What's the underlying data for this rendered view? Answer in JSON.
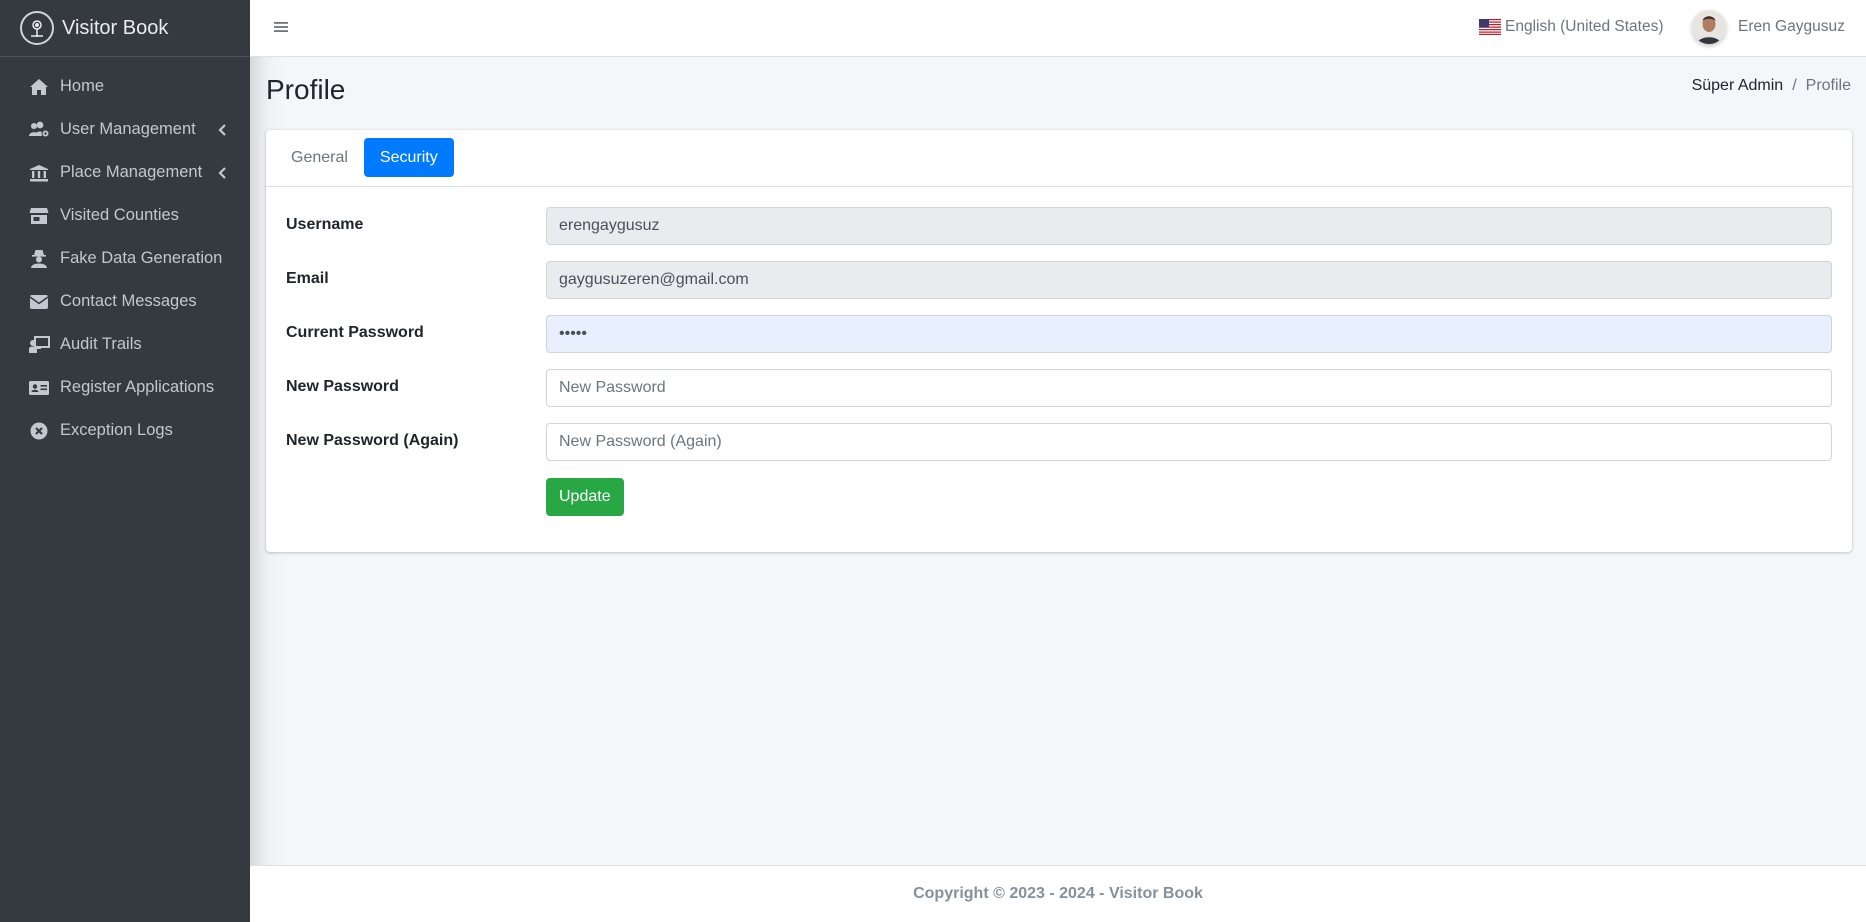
{
  "brand": {
    "name": "Visitor Book",
    "icon": "compass-logo-icon"
  },
  "sidebar": {
    "items": [
      {
        "label": "Home",
        "icon": "home-icon",
        "has_submenu": false
      },
      {
        "label": "User Management",
        "icon": "users-cog-icon",
        "has_submenu": true
      },
      {
        "label": "Place Management",
        "icon": "landmark-icon",
        "has_submenu": true
      },
      {
        "label": "Visited Counties",
        "icon": "store-icon",
        "has_submenu": false
      },
      {
        "label": "Fake Data Generation",
        "icon": "user-secret-icon",
        "has_submenu": false
      },
      {
        "label": "Contact Messages",
        "icon": "envelope-icon",
        "has_submenu": false
      },
      {
        "label": "Audit Trails",
        "icon": "chalkboard-teacher-icon",
        "has_submenu": false
      },
      {
        "label": "Register Applications",
        "icon": "id-card-icon",
        "has_submenu": false
      },
      {
        "label": "Exception Logs",
        "icon": "times-circle-icon",
        "has_submenu": false
      }
    ]
  },
  "topbar": {
    "language": "English (United States)",
    "user_name": "Eren Gaygusuz"
  },
  "page": {
    "title": "Profile",
    "breadcrumb": {
      "parent": "Süper Admin",
      "separator": "/",
      "current": "Profile"
    }
  },
  "tabs": [
    {
      "label": "General",
      "active": false
    },
    {
      "label": "Security",
      "active": true
    }
  ],
  "form": {
    "username": {
      "label": "Username",
      "value": "erengaygusuz",
      "placeholder": ""
    },
    "email": {
      "label": "Email",
      "value": "gaygusuzeren@gmail.com",
      "placeholder": ""
    },
    "current_password": {
      "label": "Current Password",
      "value": "•••••",
      "placeholder": ""
    },
    "new_password": {
      "label": "New Password",
      "value": "",
      "placeholder": "New Password"
    },
    "new_password_again": {
      "label": "New Password (Again)",
      "value": "",
      "placeholder": "New Password (Again)"
    },
    "update_label": "Update"
  },
  "footer": {
    "text": "Copyright © 2023 - 2024 - Visitor Book"
  },
  "colors": {
    "sidebar_bg": "#343a40",
    "primary": "#007bff",
    "success": "#28a745",
    "content_bg": "#f4f6f9"
  }
}
